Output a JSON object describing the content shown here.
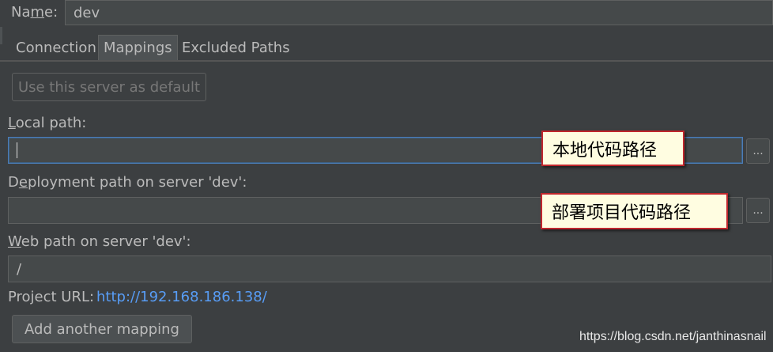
{
  "name_field": {
    "label": "Name:",
    "value": "dev"
  },
  "tabs": [
    {
      "label": "Connection",
      "active": false
    },
    {
      "label": "Mappings",
      "active": true
    },
    {
      "label": "Excluded Paths",
      "active": false
    }
  ],
  "default_button": {
    "label": "Use this server as default",
    "enabled": false
  },
  "local_path": {
    "label": "Local path:",
    "value": "",
    "browse": "..."
  },
  "deployment_path": {
    "label": "Deployment path on server 'dev':",
    "value": "",
    "browse": "..."
  },
  "web_path": {
    "label": "Web path on server 'dev':",
    "value": "/"
  },
  "project_url": {
    "label": "Project URL:",
    "value": "http://192.168.186.138/"
  },
  "add_mapping_button": {
    "label": "Add another mapping"
  },
  "annotations": {
    "local_path_note": "本地代码路径",
    "deployment_path_note": "部署项目代码路径"
  },
  "watermark": "https://blog.csdn.net/janthinasnail",
  "colors": {
    "background": "#3c3f41",
    "field": "#45494a",
    "focus_border": "#4b7db8",
    "link": "#589df6",
    "callout_border": "#c0272d",
    "callout_fill": "#fffde1"
  }
}
